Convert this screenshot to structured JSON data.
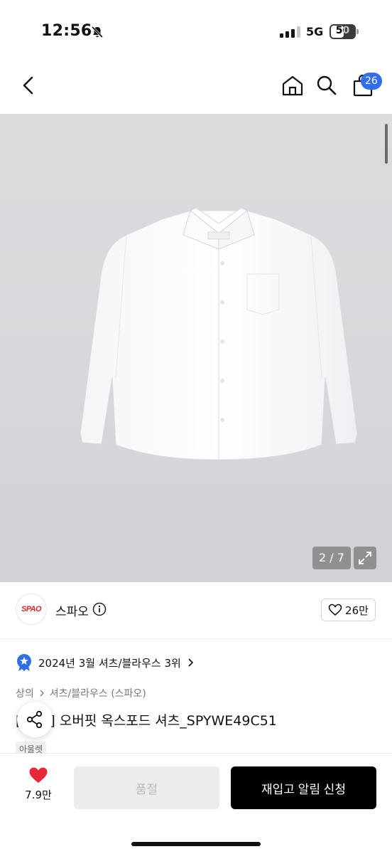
{
  "status_bar": {
    "time": "12:56",
    "network": "5G",
    "battery": "50"
  },
  "nav": {
    "cart_count": "26",
    "icons": [
      "back-icon",
      "home-icon",
      "search-icon",
      "shopping-bag-icon"
    ]
  },
  "gallery": {
    "counter": "2 / 7",
    "icons": [
      "expand-icon"
    ]
  },
  "brand": {
    "logo_text": "SPAO",
    "name": "스파오",
    "likes": "26만",
    "icons": [
      "info-icon",
      "heart-outline-icon"
    ]
  },
  "ranking": {
    "text": "2024년 3월 셔츠/블라우스 3위",
    "icons": [
      "rank-badge-icon",
      "chevron-right-icon"
    ]
  },
  "breadcrumb": {
    "level1": "상의",
    "level2": "셔츠/블라우스 (스파오)"
  },
  "product": {
    "title": "[  프리] 오버핏 옥스포드 셔츠_SPYWE49C51",
    "badge": "아울렛"
  },
  "bottom_bar": {
    "wish_count": "7.9만",
    "soldout_label": "품절",
    "restock_label": "재입고 알림 신청",
    "icons": [
      "heart-filled-icon",
      "share-icon"
    ]
  },
  "colors": {
    "accent_badge": "#2f6fe8",
    "heart": "#e8283a",
    "primary_button": "#000000",
    "disabled_button": "#ececec"
  }
}
